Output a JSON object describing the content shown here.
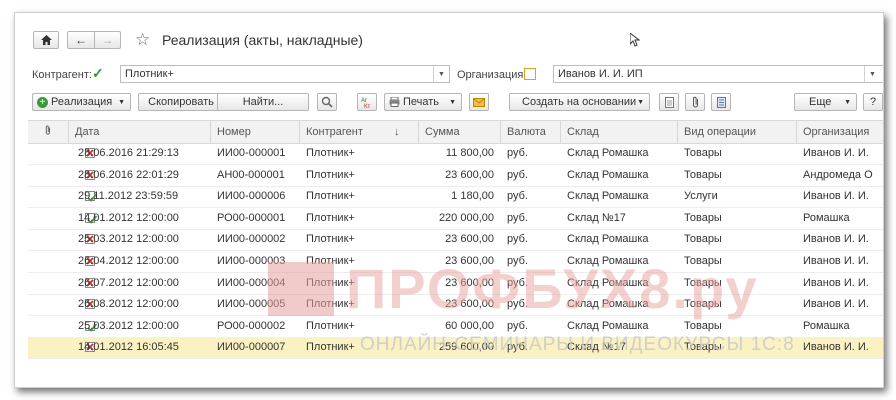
{
  "window": {
    "title": "Реализация (акты, накладные)"
  },
  "filters": {
    "counterparty_label": "Контрагент:",
    "counterparty_value": "Плотник+",
    "organization_label": "Организация:",
    "organization_value": "Иванов И. И. ИП"
  },
  "toolbar": {
    "realization": "Реализация",
    "copy": "Скопировать",
    "find": "Найти...",
    "print": "Печать",
    "create_based": "Создать на основании",
    "more": "Еще",
    "help": "?"
  },
  "table": {
    "columns": [
      "Дата",
      "Номер",
      "Контрагент",
      "Сумма",
      "Валюта",
      "Склад",
      "Вид операции",
      "Организация"
    ],
    "sort_indicator": "↓",
    "rows": [
      {
        "status": "deleted",
        "date": "28.06.2016 21:29:13",
        "number": "ИИ00-000001",
        "counterparty": "Плотник+",
        "sum": "11 800,00",
        "currency": "руб.",
        "warehouse": "Склад Ромашка",
        "operation": "Товары",
        "org": "Иванов И. И."
      },
      {
        "status": "deleted",
        "date": "28.06.2016 22:01:29",
        "number": "АН00-000001",
        "counterparty": "Плотник+",
        "sum": "23 600,00",
        "currency": "руб.",
        "warehouse": "Склад Ромашка",
        "operation": "Товары",
        "org": "Андромеда О"
      },
      {
        "status": "posted",
        "date": "29.11.2012 23:59:59",
        "number": "ИИ00-000006",
        "counterparty": "Плотник+",
        "sum": "1 180,00",
        "currency": "руб.",
        "warehouse": "Склад Ромашка",
        "operation": "Услуги",
        "org": "Иванов И. И."
      },
      {
        "status": "posted",
        "date": "14.01.2012 12:00:00",
        "number": "РО00-000001",
        "counterparty": "Плотник+",
        "sum": "220 000,00",
        "currency": "руб.",
        "warehouse": "Склад №17",
        "operation": "Товары",
        "org": "Ромашка"
      },
      {
        "status": "deleted",
        "date": "25.03.2012 12:00:00",
        "number": "ИИ00-000002",
        "counterparty": "Плотник+",
        "sum": "23 600,00",
        "currency": "руб.",
        "warehouse": "Склад Ромашка",
        "operation": "Товары",
        "org": "Иванов И. И."
      },
      {
        "status": "deleted",
        "date": "26.04.2012 12:00:00",
        "number": "ИИ00-000003",
        "counterparty": "Плотник+",
        "sum": "23 600,00",
        "currency": "руб.",
        "warehouse": "Склад Ромашка",
        "operation": "Товары",
        "org": "Иванов И. И."
      },
      {
        "status": "deleted",
        "date": "26.07.2012 12:00:00",
        "number": "ИИ00-000004",
        "counterparty": "Плотник+",
        "sum": "23 600,00",
        "currency": "руб.",
        "warehouse": "Склад Ромашка",
        "operation": "Товары",
        "org": "Иванов И. И."
      },
      {
        "status": "deleted",
        "date": "26.08.2012 12:00:00",
        "number": "ИИ00-000005",
        "counterparty": "Плотник+",
        "sum": "23 600,00",
        "currency": "руб.",
        "warehouse": "Склад Ромашка",
        "operation": "Товары",
        "org": "Иванов И. И."
      },
      {
        "status": "posted",
        "date": "25.03.2012 12:00:00",
        "number": "РО00-000002",
        "counterparty": "Плотник+",
        "sum": "60 000,00",
        "currency": "руб.",
        "warehouse": "Склад Ромашка",
        "operation": "Товары",
        "org": "Ромашка"
      },
      {
        "status": "deleted",
        "date": "14.01.2012 16:05:45",
        "number": "ИИ00-000007",
        "counterparty": "Плотник+",
        "sum": "259 600,00",
        "currency": "руб.",
        "warehouse": "Склад №17",
        "operation": "Товары",
        "org": "Иванов И. И."
      }
    ],
    "selected_row": 9
  },
  "watermark": {
    "main": "ПРОФБУХ8.ру",
    "sub": "ОНЛАЙН-СЕМИНАРЫ И ВИДЕОКУРСЫ 1С:8"
  },
  "colors": {
    "selected_row": "#fbf2c3",
    "posted_icon": "#3a9a3a",
    "deleted_icon": "#c43030"
  }
}
